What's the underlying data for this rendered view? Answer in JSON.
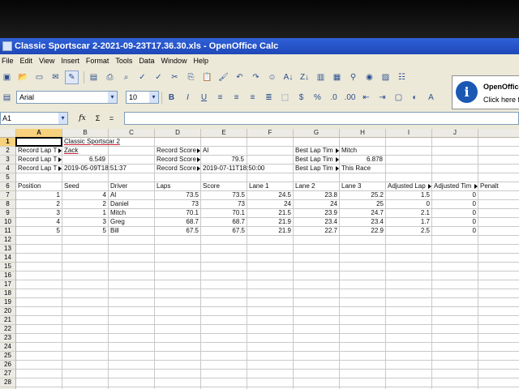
{
  "window_title": "Classic Sportscar 2-2021-09-23T17.36.30.xls - OpenOffice Calc",
  "menu": [
    "File",
    "Edit",
    "View",
    "Insert",
    "Format",
    "Tools",
    "Data",
    "Window",
    "Help"
  ],
  "toolbar": {
    "font_name": "Arial",
    "font_size": "10",
    "bold": "B",
    "italic": "I",
    "underline": "U"
  },
  "tooltip": {
    "title": "OpenOffice",
    "text": "Click here fo"
  },
  "formula": {
    "cell_ref": "A1",
    "value": ""
  },
  "columns": [
    "A",
    "B",
    "C",
    "D",
    "E",
    "F",
    "G",
    "H",
    "I",
    "J"
  ],
  "rows": [
    "1",
    "2",
    "3",
    "4",
    "5",
    "6",
    "7",
    "8",
    "9",
    "10",
    "11",
    "12",
    "13",
    "14",
    "15",
    "16",
    "17",
    "18",
    "19",
    "20",
    "21",
    "22",
    "23",
    "24",
    "25",
    "26",
    "27",
    "28"
  ],
  "sheet": {
    "title": "Classic Sportscar 2",
    "record_lap_1_label": "Record Lap T",
    "record_lap_1_value": "Zack",
    "record_lap_2_label": "Record Lap T",
    "record_lap_2_value": "6.549",
    "record_lap_3_label": "Record Lap T",
    "record_lap_3_value": "2019-05-09T18:51:37",
    "record_score_1_label": "Record Score",
    "record_score_1_value": "Al",
    "record_score_2_label": "Record Score",
    "record_score_2_value": "79.5",
    "record_score_3_label": "Record Score",
    "record_score_3_value": "2019-07-11T18:50:00",
    "best_lap_1_label": "Best Lap Tim",
    "best_lap_1_value": "Mitch",
    "best_lap_2_label": "Best Lap Tim",
    "best_lap_2_value": "6.878",
    "best_lap_3_label": "Best Lap Tim",
    "best_lap_3_value": "This Race",
    "headers": [
      "Position",
      "Seed",
      "Driver",
      "Laps",
      "Score",
      "Lane 1",
      "Lane 2",
      "Lane 3",
      "Adjusted Lap",
      "Adjusted Tim",
      "Penalt"
    ],
    "data_rows": [
      [
        "1",
        "4",
        "Al",
        "73.5",
        "73.5",
        "24.5",
        "23.8",
        "25.2",
        "1.5",
        "0"
      ],
      [
        "2",
        "2",
        "Daniel",
        "73",
        "73",
        "24",
        "24",
        "25",
        "0",
        "0"
      ],
      [
        "3",
        "1",
        "Mitch",
        "70.1",
        "70.1",
        "21.5",
        "23.9",
        "24.7",
        "2.1",
        "0"
      ],
      [
        "4",
        "3",
        "Greg",
        "68.7",
        "68.7",
        "21.9",
        "23.4",
        "23.4",
        "1.7",
        "0"
      ],
      [
        "5",
        "5",
        "Bill",
        "67.5",
        "67.5",
        "21.9",
        "22.7",
        "22.9",
        "2.5",
        "0"
      ]
    ]
  }
}
